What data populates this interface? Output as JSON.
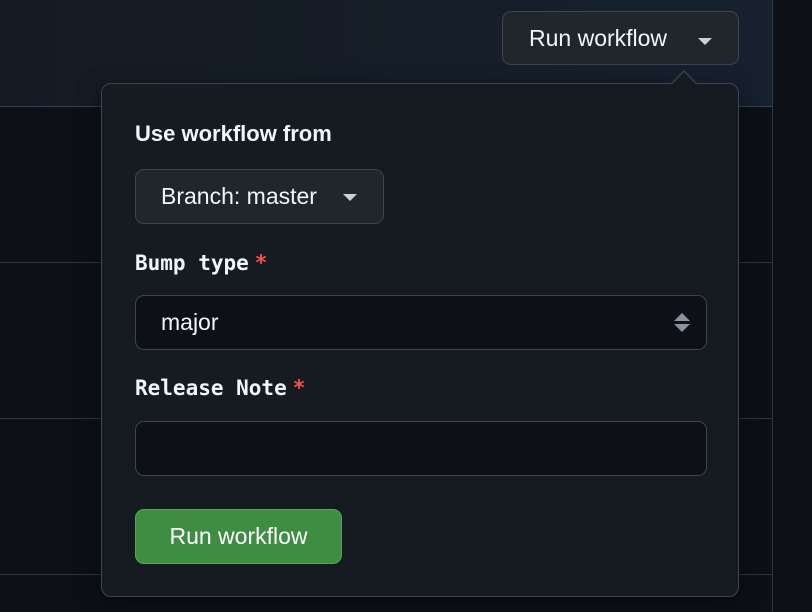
{
  "header": {
    "run_workflow_button": "Run workflow"
  },
  "popover": {
    "use_workflow_from_label": "Use workflow from",
    "branch_button": "Branch: master",
    "fields": {
      "bump_type": {
        "label": "Bump type",
        "required_mark": "*",
        "selected_value": "major"
      },
      "release_note": {
        "label": "Release Note",
        "required_mark": "*",
        "value": "",
        "placeholder": ""
      }
    },
    "submit_button": "Run workflow"
  },
  "colors": {
    "page_background": "#0d1117",
    "popover_background": "#161b22",
    "button_background": "#21262d",
    "border": "#3d444d",
    "primary_green": "#3f8c43",
    "required_red": "#f85149",
    "text": "#f0f6fc"
  },
  "icons": {
    "dropdown_caret": "chevron-down-icon",
    "select_arrows": "select-updown-icon"
  }
}
